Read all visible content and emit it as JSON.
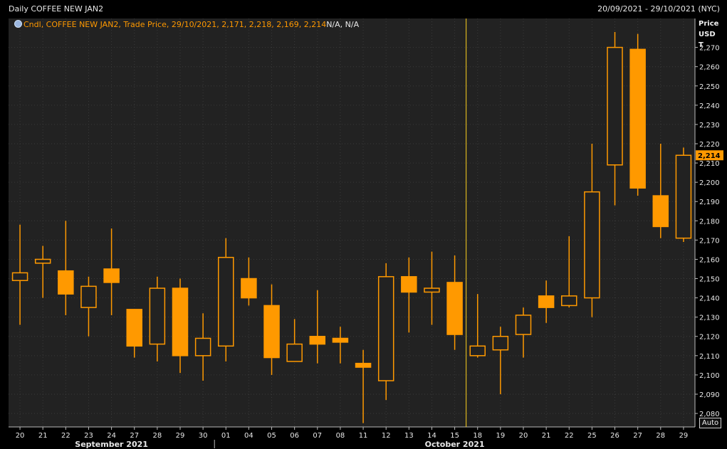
{
  "header": {
    "title": "Daily COFFEE NEW JAN2",
    "date_range": "20/09/2021 - 29/10/2021 (NYC)"
  },
  "legend": {
    "text": "Cndl, COFFEE NEW JAN2, Trade Price, 29/10/2021, 2,171, 2,218, 2,169, 2,214",
    "suffix": "N/A, N/A",
    "icon": "chart-settings-icon"
  },
  "axis_header": {
    "line1": "Price",
    "line2": "USD",
    "line3": "T"
  },
  "auto_button": "Auto",
  "colors": {
    "candle": "#ff9900",
    "background": "#222222",
    "grid": "#3a3a3a",
    "month_divider": "#ffd21f"
  },
  "chart_data": {
    "type": "candlestick",
    "x": [
      "20",
      "21",
      "22",
      "23",
      "24",
      "27",
      "28",
      "29",
      "30",
      "01",
      "04",
      "05",
      "06",
      "07",
      "08",
      "11",
      "12",
      "13",
      "14",
      "15",
      "18",
      "19",
      "20",
      "21",
      "22",
      "25",
      "26",
      "27",
      "28",
      "29"
    ],
    "open": [
      2149,
      2158,
      2154,
      2135,
      2155,
      2134,
      2116,
      2145,
      2110,
      2115,
      2150,
      2136,
      2107,
      2120,
      2119,
      2106,
      2097,
      2151,
      2143,
      2148,
      2110,
      2113,
      2121,
      2141,
      2136,
      2140,
      2209,
      2269,
      2193,
      2171
    ],
    "high": [
      2178,
      2167,
      2180,
      2151,
      2176,
      2134,
      2151,
      2150,
      2132,
      2171,
      2161,
      2147,
      2129,
      2144,
      2125,
      2113,
      2158,
      2161,
      2164,
      2162,
      2142,
      2125,
      2135,
      2149,
      2172,
      2220,
      2278,
      2277,
      2220,
      2218
    ],
    "low": [
      2126,
      2140,
      2131,
      2120,
      2131,
      2109,
      2107,
      2101,
      2097,
      2107,
      2136,
      2100,
      2107,
      2106,
      2106,
      2075,
      2087,
      2122,
      2126,
      2113,
      2109,
      2090,
      2109,
      2127,
      2135,
      2130,
      2188,
      2193,
      2171,
      2169
    ],
    "close": [
      2153,
      2160,
      2142,
      2146,
      2148,
      2115,
      2145,
      2110,
      2119,
      2161,
      2140,
      2109,
      2116,
      2116,
      2117,
      2104,
      2151,
      2143,
      2145,
      2121,
      2115,
      2120,
      2131,
      2135,
      2141,
      2195,
      2270,
      2197,
      2177,
      2214
    ],
    "last_price_label": "2,214",
    "y_ticks": [
      "2,080",
      "2,090",
      "2,100",
      "2,110",
      "2,120",
      "2,130",
      "2,140",
      "2,150",
      "2,160",
      "2,170",
      "2,180",
      "2,190",
      "2,200",
      "2,210",
      "2,220",
      "2,230",
      "2,240",
      "2,250",
      "2,260",
      "2,270"
    ],
    "y_tick_values": [
      2080,
      2090,
      2100,
      2110,
      2120,
      2130,
      2140,
      2150,
      2160,
      2170,
      2180,
      2190,
      2200,
      2210,
      2220,
      2230,
      2240,
      2250,
      2260,
      2270
    ],
    "ylim": [
      2073,
      2285
    ],
    "months": [
      {
        "label": "September 2021",
        "start_index": 0,
        "end_index": 8
      },
      {
        "label": "October 2021",
        "start_index": 9,
        "end_index": 29
      }
    ],
    "grid": true
  }
}
